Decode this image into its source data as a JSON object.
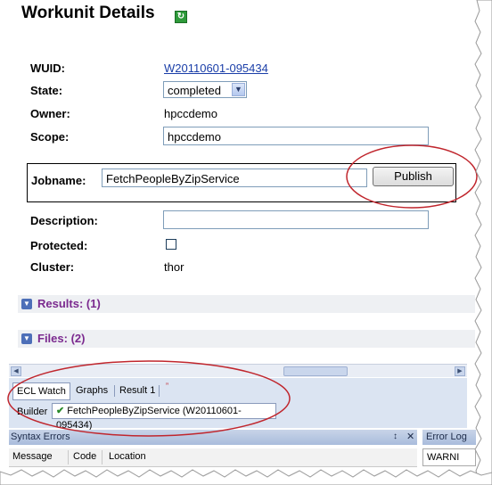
{
  "title": "Workunit Details",
  "refresh_icon": "refresh-icon",
  "fields": {
    "wuid_label": "WUID:",
    "wuid_value": "W20110601-095434",
    "state_label": "State:",
    "state_value": "completed",
    "owner_label": "Owner:",
    "owner_value": "hpccdemo",
    "scope_label": "Scope:",
    "scope_value": "hpccdemo",
    "jobname_label": "Jobname:",
    "jobname_value": "FetchPeopleByZipService",
    "publish_label": "Publish",
    "description_label": "Description:",
    "description_value": "",
    "protected_label": "Protected:",
    "cluster_label": "Cluster:",
    "cluster_value": "thor"
  },
  "sections": {
    "results": "Results: (1)",
    "files": "Files: (2)"
  },
  "tabs": [
    "ECL Watch",
    "Graphs",
    "Result 1"
  ],
  "builder": {
    "label": "Builder",
    "value": "FetchPeopleByZipService (W20110601-095434)"
  },
  "panel": {
    "title": "Syntax Errors",
    "error_log": "Error Log",
    "columns": [
      "Message",
      "Code",
      "Location"
    ],
    "warning": "WARNI"
  },
  "colors": {
    "section_text": "#7b2a8f",
    "link": "#1a3ea8",
    "annotation": "#c0262d"
  }
}
